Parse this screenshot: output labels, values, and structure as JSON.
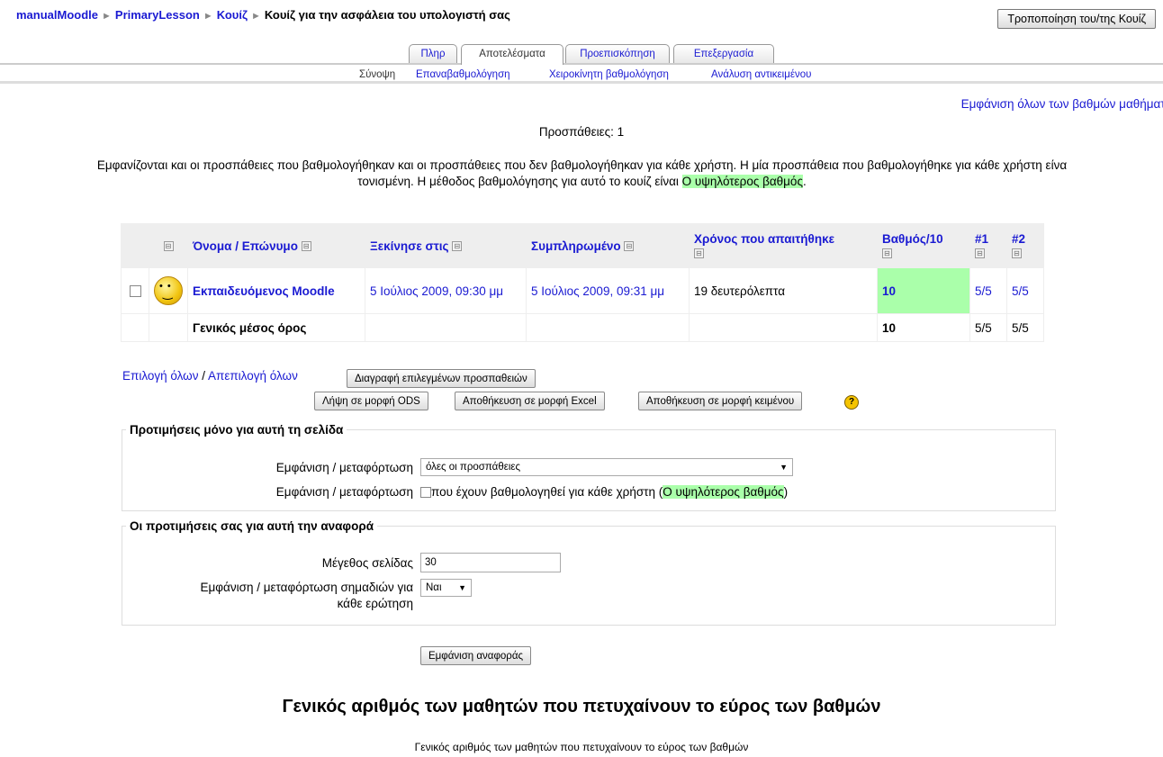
{
  "breadcrumb": {
    "items": [
      "manualMoodle",
      "PrimaryLesson",
      "Κουίζ"
    ],
    "current": "Κουίζ για την ασφάλεια του υπολογιστή σας",
    "separator": "►"
  },
  "header": {
    "edit_button": "Τροποποίηση του/της Κουίζ"
  },
  "tabs": [
    {
      "label": "Πληρ",
      "active": false
    },
    {
      "label": "Αποτελέσματα",
      "active": true
    },
    {
      "label": "Προεπισκόπηση",
      "active": false
    },
    {
      "label": "Επεξεργασία",
      "active": false
    }
  ],
  "subtabs": [
    "Σύνοψη",
    "Επαναβαθμολόγηση",
    "Χειροκίνητη βαθμολόγηση",
    "Ανάλυση αντικειμένου"
  ],
  "show_all_link": "Εμφάνιση όλων των βαθμών μαθήματο",
  "attempts_text": "Προσπάθειες: 1",
  "info": {
    "line1": "Εμφανίζονται και οι προσπάθειες που βαθμολογήθηκαν και οι προσπάθειες που δεν βαθμολογήθηκαν για κάθε χρήστη. Η μία προσπάθεια που βαθμολογήθηκε για κάθε χρήστη είνα",
    "line2_prefix": "τονισμένη. Η μέθοδος βαθμολόγησης για αυτό το κουίζ είναι ",
    "method": "Ο υψηλότερος βαθμός",
    "line2_suffix": "."
  },
  "table": {
    "collapse_icon": "⊟",
    "headers": {
      "name": "Όνομα / Επώνυμο",
      "started": "Ξεκίνησε στις",
      "completed": "Συμπληρωμένο",
      "time_taken": "Χρόνος που απαιτήθηκε",
      "grade": "Βαθμός/10",
      "q1": "#1",
      "q2": "#2"
    },
    "rows": [
      {
        "name": "Εκπαιδευόμενος Moodle",
        "started": "5 Ιούλιος 2009, 09:30 μμ",
        "completed": "5 Ιούλιος 2009, 09:31 μμ",
        "time_taken": "19 δευτερόλεπτα",
        "grade": "10",
        "q1": "5/5",
        "q2": "5/5"
      }
    ],
    "average": {
      "label": "Γενικός μέσος όρος",
      "grade": "10",
      "q1": "5/5",
      "q2": "5/5"
    }
  },
  "selection": {
    "select_all": "Επιλογή όλων",
    "slash": "/",
    "deselect_all": "Απεπιλογή όλων",
    "delete_button": "Διαγραφή επιλεγμένων προσπαθειών"
  },
  "downloads": {
    "ods": "Λήψη σε μορφή ODS",
    "excel": "Αποθήκευση σε μορφή Excel",
    "text": "Αποθήκευση σε μορφή κειμένου",
    "help_icon": "?"
  },
  "page_prefs": {
    "legend": "Προτιμήσεις μόνο για αυτή τη σελίδα",
    "show_label_1": "Εμφάνιση / μεταφόρτωση",
    "attempts_select": "όλες οι προσπάθειες",
    "show_label_2": "Εμφάνιση / μεταφόρτωση",
    "graded_prefix": "που έχουν βαθμολογηθεί για κάθε χρήστη (",
    "graded_method": "Ο υψηλότερος βαθμός",
    "graded_suffix": ")"
  },
  "report_prefs": {
    "legend": "Οι προτιμήσεις σας για αυτή την αναφορά",
    "page_size_label": "Μέγεθος σελίδας",
    "page_size_value": "30",
    "marks_label_1": "Εμφάνιση / μεταφόρτωση σημαδιών για",
    "marks_label_2": "κάθε ερώτηση",
    "marks_value": "Ναι"
  },
  "show_report_button": "Εμφάνιση αναφοράς",
  "bottom_heading": "Γενικός αριθμός των μαθητών που πετυχαίνουν το εύρος των βαθμών",
  "bottom_caption": "Γενικός αριθμός των μαθητών που πετυχαίνουν το εύρος των βαθμών"
}
